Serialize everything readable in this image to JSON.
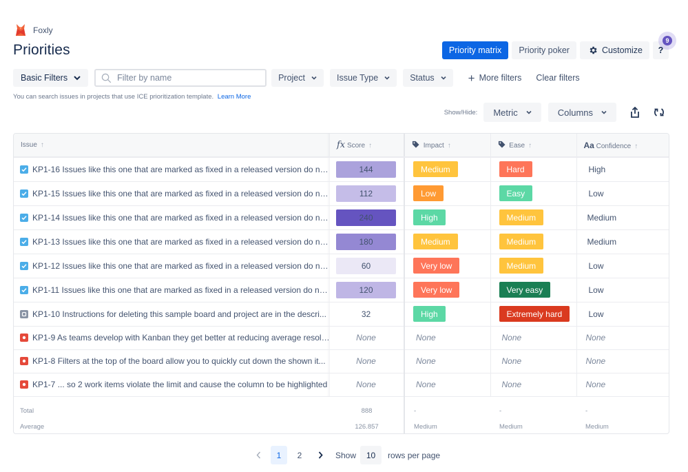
{
  "app": {
    "name": "Foxly"
  },
  "page": {
    "title": "Priorities"
  },
  "top_actions": {
    "priority_matrix": "Priority matrix",
    "priority_poker": "Priority poker",
    "customize": "Customize",
    "help": "?",
    "help_badge": "9"
  },
  "filters": {
    "basic_filters": "Basic Filters",
    "search_placeholder": "Filter by name",
    "search_value": "",
    "project": "Project",
    "issue_type": "Issue Type",
    "status": "Status",
    "more_filters": "More filters",
    "clear_filters": "Clear filters"
  },
  "hint": {
    "text": "You can search issues in projects that use ICE prioritization template.",
    "link": "Learn More"
  },
  "show_hide": {
    "label": "Show/Hide:",
    "metric": "Metric",
    "columns": "Columns"
  },
  "table": {
    "headers": {
      "issue": "Issue",
      "score": "Score",
      "impact": "Impact",
      "ease": "Ease",
      "confidence": "Confidence"
    },
    "rows": [
      {
        "type": "task",
        "key": "KP1-16",
        "summary": "Issues like this one that are marked as fixed in a released version do not ...",
        "score": "144",
        "score_color": "#aba2dc",
        "impact": "Medium",
        "impact_color": "#ffc43d",
        "ease": "Hard",
        "ease_color": "#fe7559",
        "confidence": "High"
      },
      {
        "type": "task",
        "key": "KP1-15",
        "summary": "Issues like this one that are marked as fixed in a released version do not ...",
        "score": "112",
        "score_color": "#c5bde8",
        "impact": "Low",
        "impact_color": "#ff9a33",
        "ease": "Easy",
        "ease_color": "#5cd8a5",
        "confidence": "Low"
      },
      {
        "type": "task",
        "key": "KP1-14",
        "summary": "Issues like this one that are marked as fixed in a released version do not ...",
        "score": "240",
        "score_color": "#6554c0",
        "impact": "High",
        "impact_color": "#5cd8a5",
        "ease": "Medium",
        "ease_color": "#ffc43d",
        "confidence": "Medium"
      },
      {
        "type": "task",
        "key": "KP1-13",
        "summary": "Issues like this one that are marked as fixed in a released version do not ...",
        "score": "180",
        "score_color": "#9488d3",
        "impact": "Medium",
        "impact_color": "#ffc43d",
        "ease": "Medium",
        "ease_color": "#ffc43d",
        "confidence": "Medium"
      },
      {
        "type": "task",
        "key": "KP1-12",
        "summary": "Issues like this one that are marked as fixed in a released version do not ...",
        "score": "60",
        "score_color": "#ebe8f6",
        "impact": "Very low",
        "impact_color": "#fe7559",
        "ease": "Medium",
        "ease_color": "#ffc43d",
        "confidence": "Low"
      },
      {
        "type": "task",
        "key": "KP1-11",
        "summary": "Issues like this one that are marked as fixed in a released version do not ...",
        "score": "120",
        "score_color": "#bfb6e5",
        "impact": "Very low",
        "impact_color": "#fe7559",
        "ease": "Very easy",
        "ease_color": "#1a7f54",
        "confidence": "Low"
      },
      {
        "type": "subtask",
        "key": "KP1-10",
        "summary": "Instructions for deleting this sample board and project are in the descri...",
        "score": "32",
        "score_color": "",
        "impact": "High",
        "impact_color": "#5cd8a5",
        "ease": "Extremely hard",
        "ease_color": "#da3a1f",
        "confidence": "Low"
      },
      {
        "type": "bug",
        "key": "KP1-9",
        "summary": "As teams develop with Kanban they get better at reducing average resolu...",
        "score": "None",
        "impact": "None",
        "ease": "None",
        "confidence": "None"
      },
      {
        "type": "bug",
        "key": "KP1-8",
        "summary": "Filters at the top of the board allow you to quickly cut down the shown it...",
        "score": "None",
        "impact": "None",
        "ease": "None",
        "confidence": "None"
      },
      {
        "type": "bug",
        "key": "KP1-7",
        "summary": "... so 2 work items violate the limit and cause the column to be highlighted",
        "score": "None",
        "impact": "None",
        "ease": "None",
        "confidence": "None"
      }
    ],
    "footer": {
      "total_label": "Total",
      "average_label": "Average",
      "score_total": "888",
      "score_average": "126.857",
      "impact_total": "-",
      "impact_average": "Medium",
      "ease_total": "-",
      "ease_average": "Medium",
      "confidence_total": "-",
      "confidence_average": "Medium"
    }
  },
  "pagination": {
    "pages": [
      "1",
      "2"
    ],
    "current_page": "1",
    "show_label": "Show",
    "rows_per_page": "10",
    "rows_per_page_label": "rows per page"
  }
}
